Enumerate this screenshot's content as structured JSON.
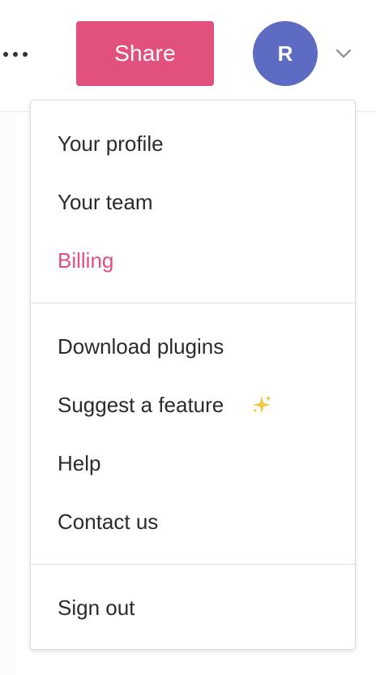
{
  "header": {
    "more_icon": "more-horizontal-icon",
    "share_label": "Share",
    "avatar_initial": "R",
    "caret_icon": "chevron-down-icon",
    "colors": {
      "share": "#e2507e",
      "avatar": "#5d6bc2"
    }
  },
  "menu": {
    "sections": [
      [
        {
          "label": "Your profile"
        },
        {
          "label": "Your team"
        },
        {
          "label": "Billing",
          "active": true
        }
      ],
      [
        {
          "label": "Download plugins"
        },
        {
          "label": "Suggest a feature",
          "icon": "sparkles-icon"
        },
        {
          "label": "Help"
        },
        {
          "label": "Contact us"
        }
      ],
      [
        {
          "label": "Sign out"
        }
      ]
    ],
    "colors": {
      "active": "#e2507e",
      "text": "#2b2b2b"
    }
  }
}
